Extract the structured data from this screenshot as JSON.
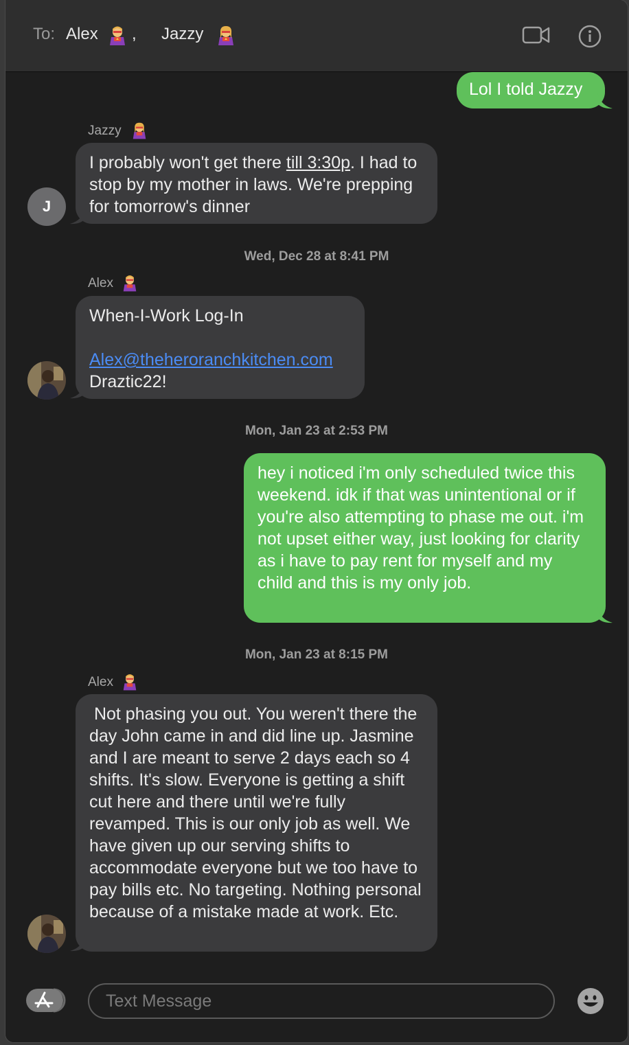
{
  "header": {
    "to_label": "To:",
    "recipients": [
      {
        "name": "Alex"
      },
      {
        "name": "Jazzy"
      }
    ],
    "separator": ","
  },
  "messages": {
    "out_1": {
      "text": "Lol I told Jazzy"
    },
    "jazzy_sender": "Jazzy",
    "jazzy_avatar_initial": "J",
    "in_1": {
      "pre": "I probably won't get there ",
      "underlined": "till 3:30p",
      "post": ". I had to stop by my mother in laws. We're prepping for tomorrow's dinner"
    },
    "ts_1": "Wed, Dec 28 at 8:41 PM",
    "alex_sender_1": "Alex",
    "in_2": {
      "line1": "When-I-Work Log-In",
      "email": "Alex@theheroranchkitchen.com",
      "password": "Draztic22!"
    },
    "ts_2": "Mon, Jan 23 at 2:53 PM",
    "out_2": {
      "text": "hey i noticed i'm only scheduled twice this weekend. idk if that was unintentional or if you're also attempting to phase me out. i'm not upset either way, just looking for clarity as i have to pay rent for myself and my child and this is my only job."
    },
    "ts_3": "Mon, Jan 23 at 8:15 PM",
    "alex_sender_2": "Alex",
    "in_3": {
      "text": " Not phasing you out. You weren't there the day John came in and did line up. Jasmine and I are meant to serve 2 days each so 4 shifts. It's slow. Everyone is getting a shift cut here and there until we're fully revamped. This is our only job as well. We have given up our serving shifts to accommodate everyone but we too have to pay bills etc. No targeting. Nothing personal because of a mistake made at work. Etc."
    }
  },
  "composer": {
    "placeholder": "Text Message"
  },
  "colors": {
    "outgoing_bubble": "#5fc05b",
    "incoming_bubble": "#3b3b3d",
    "link": "#4b8cf5"
  },
  "icons": {
    "video": "video-camera-icon",
    "info": "info-icon",
    "apps": "app-store-icon",
    "emoji": "emoji-icon",
    "recipient_emoji": "superhero-emoji-icon"
  }
}
